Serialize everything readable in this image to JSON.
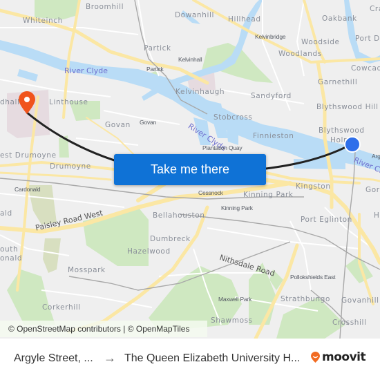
{
  "map": {
    "labels": {
      "broomhill": "Broomhill",
      "whiteinch": "Whiteinch",
      "dowanhill": "Dowanhill",
      "hillhead": "Hillhead",
      "oakbank": "Oakbank",
      "cra": "Cra",
      "kelvinbridge": "Kelvinbridge",
      "woodside": "Woodside",
      "port_dundas": "Port Du",
      "woodlands": "Woodlands",
      "cowcaddens": "Cowcad",
      "partick_area": "Partick",
      "partick_stn": "Partick",
      "kelvinhall": "Kelvinhall",
      "kelvinhaugh": "Kelvinhaugh",
      "garnethill": "Garnethill",
      "river_clyde_1": "River Clyde",
      "river_clyde_2": "River Clyde",
      "river_clyde_3": "River Cl",
      "sandyford": "Sandyford",
      "blythswood_hill": "Blythswood Hill",
      "linthouse": "Linthouse",
      "southern_general": "dhall",
      "govan_area": "Govan",
      "govan_stn": "Govan",
      "stobcross": "Stobcross",
      "finnieston": "Finnieston",
      "blythswood_holm_1": "Blythswood",
      "blythswood_holm_2": "Holm",
      "plantation_quay": "Plantation Quay",
      "argyle": "Arg",
      "west_drumoyne": "est Drumoyne",
      "drumoyne": "Drumoyne",
      "cardonald_stn": "Cardonald",
      "cessnock": "Cessnock",
      "kingston": "Kingston",
      "gorbals": "Gorb",
      "kinning_park_area": "Kinning Park",
      "kinning_park_stn": "Kinning Park",
      "cardonald_area": "ald",
      "paisley_road_west": "Paisley Road West",
      "bellahouston": "Bellahouston",
      "port_eglinton": "Port Eglinton",
      "hutchesontown": "H",
      "dumbreck": "Dumbreck",
      "hazelwood": "Hazelwood",
      "south_cardonald_1": "outh",
      "south_cardonald_2": "onald",
      "nithsdale_road": "Nithsdale Road",
      "mosspark": "Mosspark",
      "pollokshields_east": "Pollokshields East",
      "maxwell_park": "Maxwell Park",
      "strathbungo": "Strathbungo",
      "govanhill": "Govanhill",
      "corkerhill": "Corkerhill",
      "shawmoss": "Shawmoss",
      "crosshill": "Crosshill"
    },
    "cta_label": "Take me there",
    "attribution": "© OpenStreetMap contributors | © OpenMapTiles",
    "colors": {
      "origin_marker": "#2f6fea",
      "destination_marker": "#f0541c",
      "route_line": "#222222",
      "water": "#b3d9f5",
      "park": "#c7e6b4",
      "road_major": "#fbe7a1",
      "cta_bg": "#0f72d6"
    }
  },
  "footer": {
    "origin": "Argyle Street, ...",
    "arrow": "→",
    "destination": "The Queen Elizabeth University H...",
    "brand": "moovit",
    "brand_color": "#f26b21"
  }
}
